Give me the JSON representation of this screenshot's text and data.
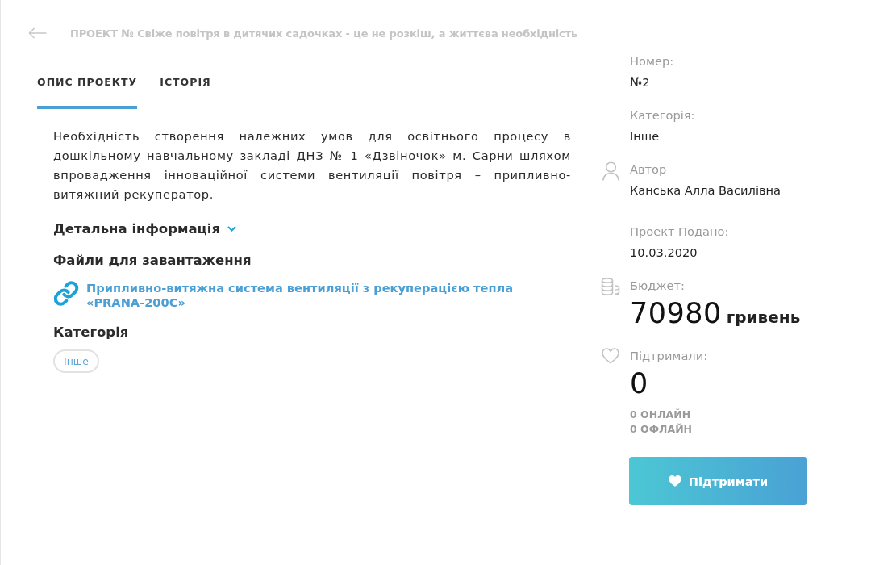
{
  "header": {
    "title": "ПРОЕКТ № Свіже повітря в дитячих садочках - це не розкіш, а життєва необхідність"
  },
  "tabs": [
    {
      "label": "ОПИС ПРОЕКТУ",
      "selected": true
    },
    {
      "label": "ІСТОРІЯ",
      "selected": false
    }
  ],
  "description": "Необхідність створення належних умов для освітнього процесу в дошкільному навчальному закладі ДНЗ № 1 «Дзвіночок» м. Сарни шляхом впровадження інноваційної системи вентиляції повітря – припливно-витяжний рекуператор.",
  "details": {
    "label": "Детальна інформація",
    "expanded": false
  },
  "files": {
    "heading": "Файли для завантаження",
    "items": [
      {
        "title": "Припливно-витяжна система вентиляції з рекуперацією тепла «PRANA-200C»"
      }
    ]
  },
  "category": {
    "heading": "Категорія",
    "tags": [
      "Інше"
    ]
  },
  "info": [
    {
      "kind": "plain",
      "label": "Номер:",
      "value": "№2"
    },
    {
      "kind": "plain",
      "label": "Категорія:",
      "value": "Інше"
    },
    {
      "kind": "author",
      "label": "Автор",
      "value": "Канська Алла Василівна"
    },
    {
      "kind": "plain",
      "label": "Проект Подано:",
      "value": "10.03.2020"
    },
    {
      "kind": "budget",
      "label": "Бюджет:",
      "value": "70980",
      "unit": "гривень"
    },
    {
      "kind": "supporters",
      "label": "Підтримали:",
      "value": "0",
      "breakdown": [
        "0 ОНЛАЙН",
        "0 ОФЛАЙН"
      ]
    }
  ],
  "support_button": {
    "label": "Підтримати"
  }
}
